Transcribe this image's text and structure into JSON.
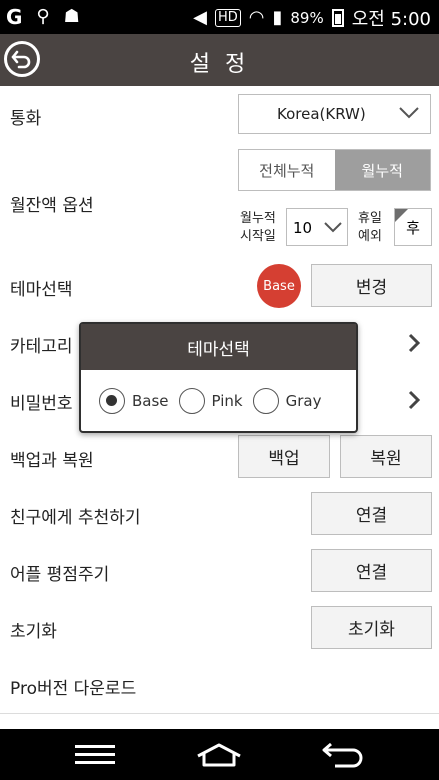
{
  "status": {
    "percent": "89%",
    "time": "오전 5:00",
    "icons": [
      "g-logo-icon",
      "usb-icon",
      "android-debug-icon",
      "mute-icon",
      "hd-voice-icon",
      "wifi-icon",
      "signal-icon",
      "battery-icon"
    ]
  },
  "appbar": {
    "title": "설 정"
  },
  "rows": {
    "currency": {
      "label": "통화",
      "value": "Korea(KRW)"
    },
    "monthly": {
      "label": "월잔액 옵션",
      "seg_all": "전체누적",
      "seg_month": "월누적",
      "start_label_1": "월누적",
      "start_label_2": "시작일",
      "start_value": "10",
      "holiday_label_1": "휴일",
      "holiday_label_2": "예외",
      "holiday_value": "후"
    },
    "theme": {
      "label": "테마선택",
      "badge": "Base",
      "button": "변경",
      "badge_color": "#d53f32"
    },
    "category": {
      "label": "카테고리"
    },
    "password": {
      "label": "비밀번호"
    },
    "backup": {
      "label": "백업과 복원",
      "backup_btn": "백업",
      "restore_btn": "복원"
    },
    "recommend": {
      "label": "친구에게 추천하기",
      "button": "연결"
    },
    "rate": {
      "label": "어플 평점주기",
      "button": "연결"
    },
    "reset": {
      "label": "초기화",
      "button": "초기화"
    },
    "pro": {
      "label": "Pro버전 다운로드"
    }
  },
  "dialog": {
    "title": "테마선택",
    "options": [
      {
        "label": "Base",
        "selected": true
      },
      {
        "label": "Pink",
        "selected": false
      },
      {
        "label": "Gray",
        "selected": false
      }
    ],
    "header_color": "#4a4442"
  }
}
